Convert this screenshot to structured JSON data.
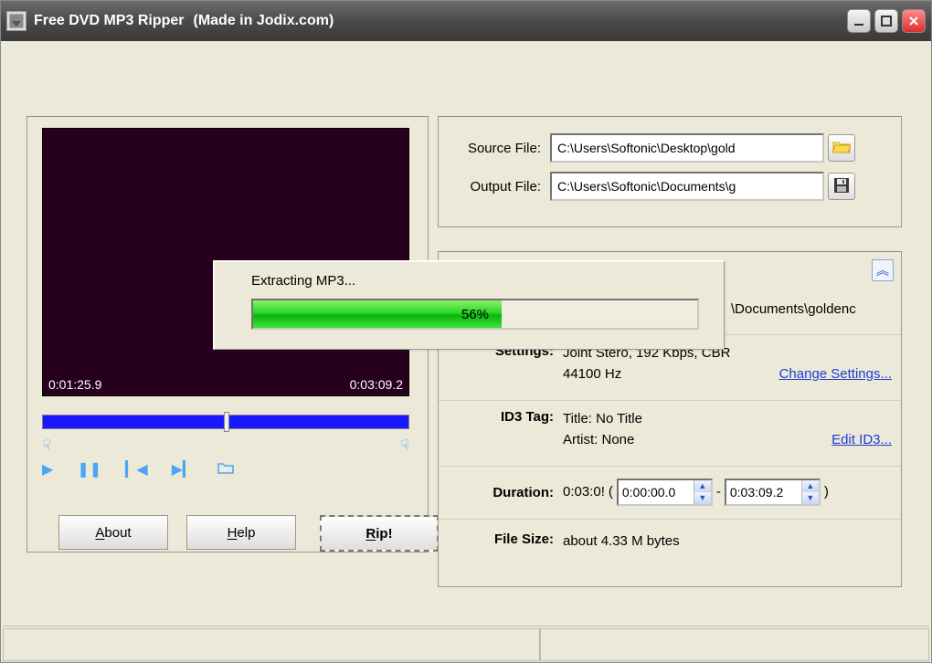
{
  "titlebar": {
    "title": "Free DVD MP3 Ripper",
    "subtitle": "(Made in Jodix.com)"
  },
  "player": {
    "current_time": "0:01:25.9",
    "total_time": "0:03:09.2"
  },
  "buttons": {
    "about": "About",
    "help": "Help",
    "rip": "Rip!"
  },
  "files": {
    "source_label": "Source File:",
    "source_value": "C:\\Users\\Softonic\\Desktop\\gold",
    "output_label": "Output File:",
    "output_value": "C:\\Users\\Softonic\\Documents\\g"
  },
  "details": {
    "output_path_tail": "\\Documents\\goldenc",
    "settings_label": "Settings:",
    "settings_line1": "Joint Stero, 192 Kbps, CBR",
    "settings_line2": "44100 Hz",
    "change_settings": "Change Settings...",
    "id3_label": "ID3 Tag:",
    "id3_title": "Title: No Title",
    "id3_artist": "Artist: None",
    "edit_id3": "Edit ID3...",
    "duration_label": "Duration:",
    "duration_total": "0:03:0!",
    "duration_from": "0:00:00.0",
    "duration_to": "0:03:09.2",
    "filesize_label": "File Size:",
    "filesize_value": "about 4.33 M bytes"
  },
  "dialog": {
    "label": "Extracting MP3...",
    "percent_text": "56%",
    "percent_value": 56
  }
}
